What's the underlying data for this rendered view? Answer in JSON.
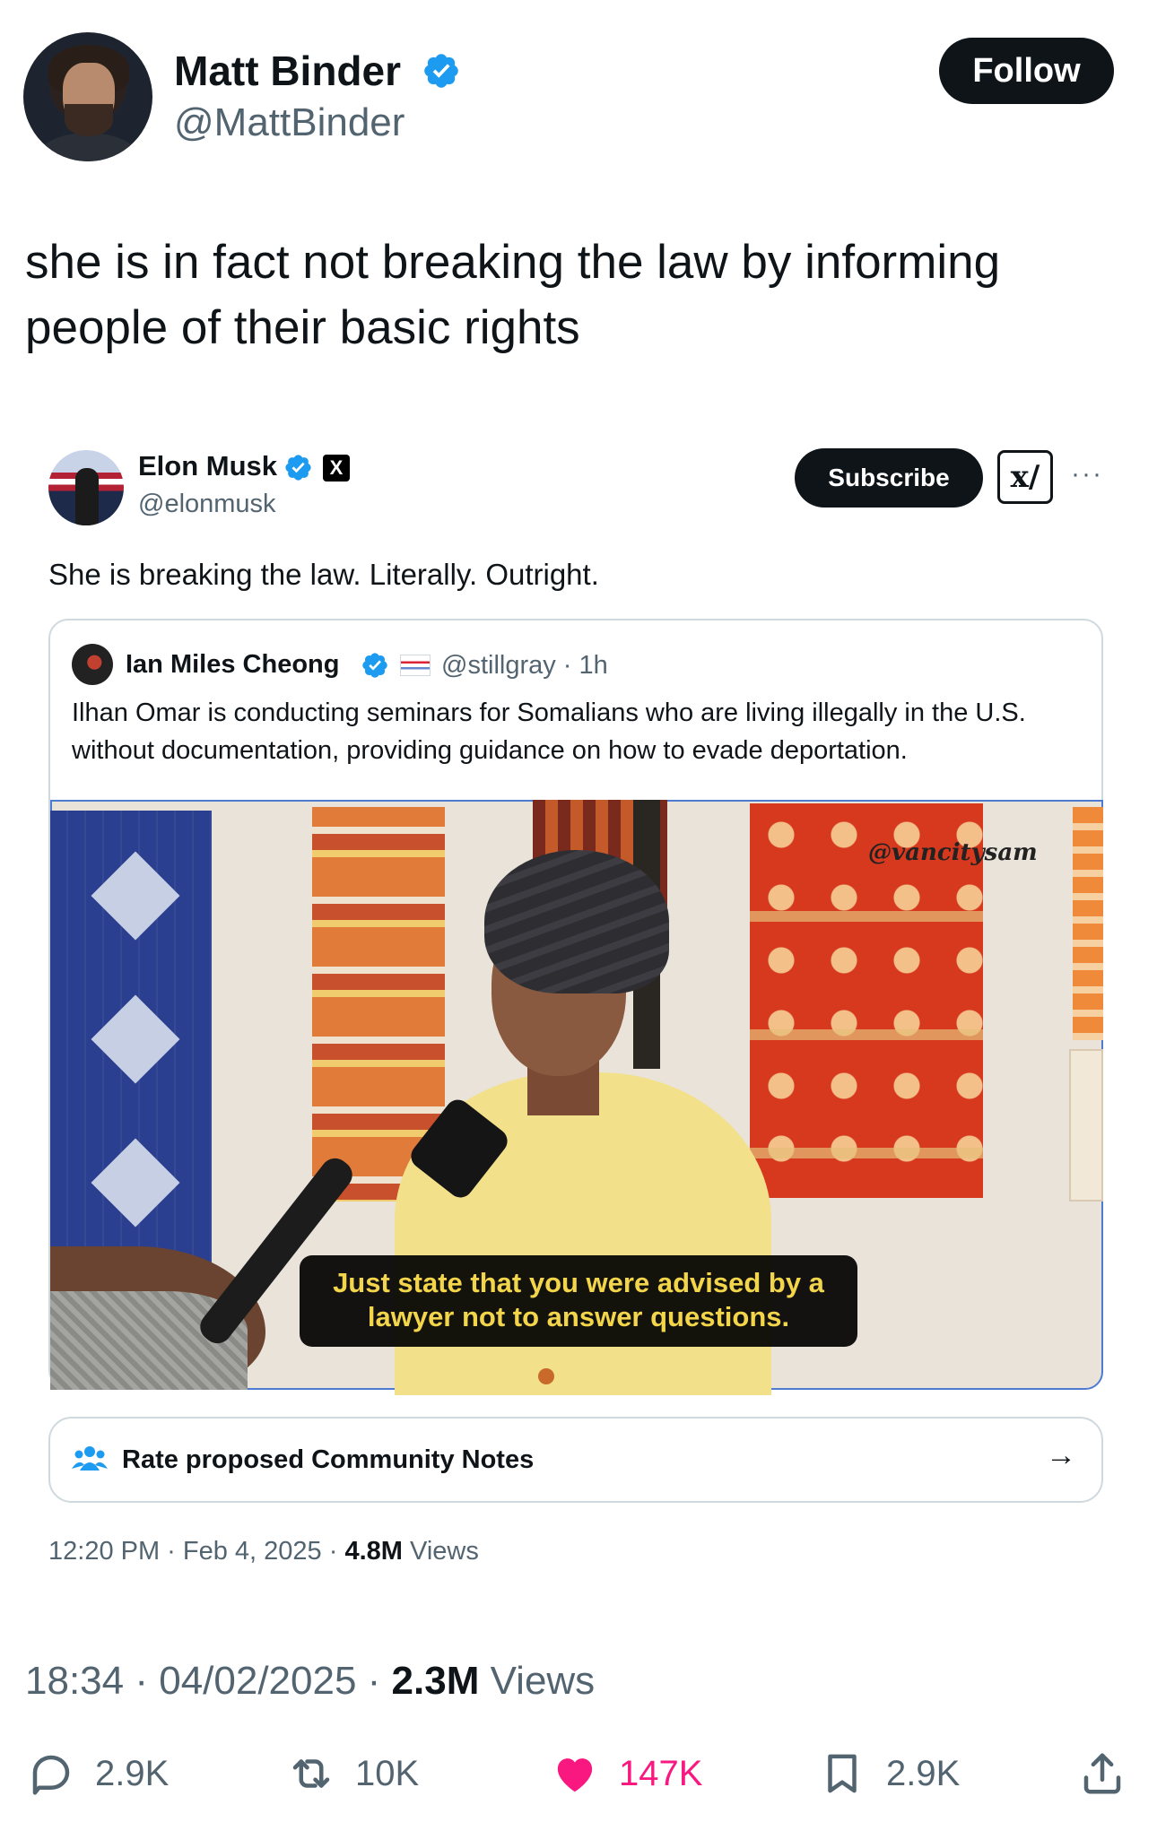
{
  "author": {
    "name": "Matt Binder",
    "handle": "@MattBinder",
    "follow_label": "Follow"
  },
  "tweet": {
    "text": "she is in fact not breaking the law by informing people of their basic rights",
    "time": "18:34",
    "date": "04/02/2025",
    "views_count": "2.3M",
    "views_label": "Views"
  },
  "embedded": {
    "name": "Elon Musk",
    "badge": "X",
    "handle": "@elonmusk",
    "subscribe_label": "Subscribe",
    "grok_label": "x/",
    "more_label": "···",
    "text": "She is breaking the law. Literally. Outright.",
    "quoted": {
      "name": "Ian Miles Cheong",
      "handle_time": "@stillgray · 1h",
      "text": "Ilhan Omar is conducting seminars for Somalians who are living illegally in the U.S. without documentation, providing guidance on how to evade deportation.",
      "video_watermark": "@vancitysam",
      "video_caption": "Just state that you were advised by a lawyer not to answer questions."
    },
    "community_notes_label": "Rate proposed Community Notes",
    "timestamp": "12:20 PM · Feb 4, 2025 · ",
    "views_count": "4.8M",
    "views_label": " Views"
  },
  "actions": {
    "reply": "2.9K",
    "repost": "10K",
    "like": "147K",
    "bookmark": "2.9K"
  },
  "colors": {
    "verified": "#1d9bf0",
    "like": "#f91880",
    "muted": "#536471",
    "text": "#0f1419"
  }
}
